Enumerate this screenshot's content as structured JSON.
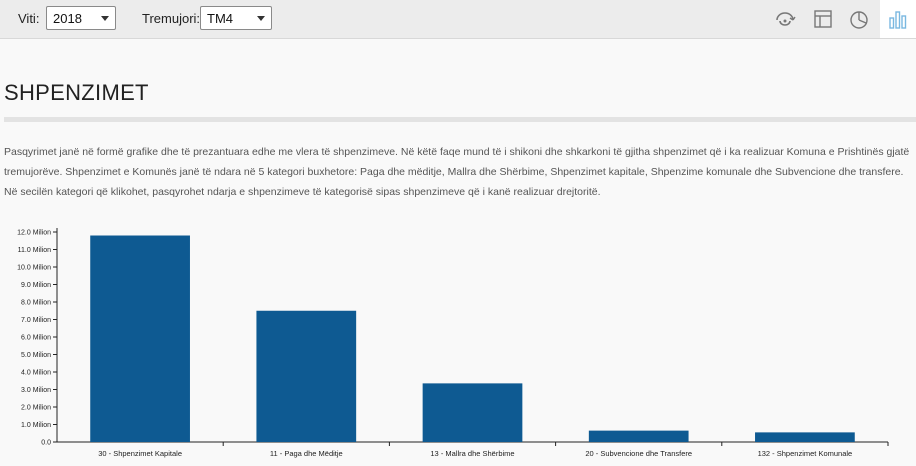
{
  "toolbar": {
    "year_label": "Viti:",
    "year_value": "2018",
    "quarter_label": "Tremujori:",
    "quarter_value": "TM4",
    "icons": [
      "refresh-icon",
      "table-icon",
      "pie-chart-icon",
      "bar-chart-icon"
    ],
    "active_color": "#7ab8e0"
  },
  "page": {
    "title": "SHPENZIMET",
    "description": "Pasqyrimet janë në formë grafike dhe të prezantuara edhe me vlera të shpenzimeve. Në këtë faqe mund të i shikoni dhe shkarkoni të gjitha shpenzimet që i ka realizuar Komuna e Prishtinës gjatë tremujorëve. Shpenzimet e Komunës janë të ndara në 5 kategori buxhetore: Paga dhe mëditje, Mallra dhe Shërbime, Shpenzimet kapitale, Shpenzime komunale dhe Subvencione dhe transfere. Në secilën kategori që klikohet, pasqyrohet ndarja e shpenzimeve të kategorisë sipas shpenzimeve që i kanë realizuar drejtoritë."
  },
  "chart_data": {
    "type": "bar",
    "categories": [
      "30 - Shpenzimet Kapitale",
      "11 - Paga dhe Mëditje",
      "13 - Mallra dhe Shërbime",
      "20 - Subvencione dhe Transfere",
      "132 - Shpenzimet Komunale"
    ],
    "values": [
      11.8,
      7.5,
      3.35,
      0.65,
      0.55
    ],
    "yticks": [
      "0.0",
      "1.0 Milion",
      "2.0 Milion",
      "3.0 Milion",
      "4.0 Milion",
      "5.0 Milion",
      "6.0 Milion",
      "7.0 Milion",
      "8.0 Milion",
      "9.0 Milion",
      "10.0 Milion",
      "11.0 Milion",
      "12.0 Milion"
    ],
    "ylim": [
      0,
      12
    ],
    "color": "#0e5a92",
    "grid": false
  }
}
